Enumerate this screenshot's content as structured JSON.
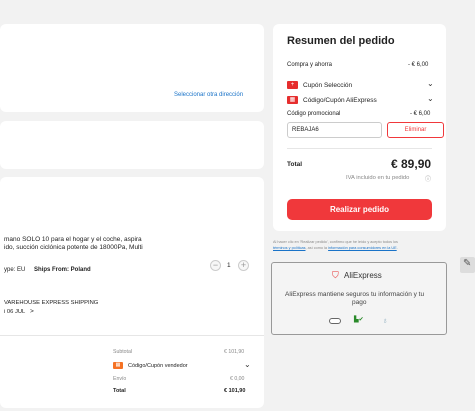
{
  "address": {
    "select_other": "Seleccionar otra dirección"
  },
  "product": {
    "title_line1": "mano SOLO 10 para el hogar y el coche, aspira",
    "title_line2": "ido, succión ciclónica potente de 18000Pa, Multi",
    "type_label": "ype: EU",
    "ships_from": "Ships From: Poland",
    "quantity": "1",
    "shipping_method": "VAREHOUSE EXPRESS SHIPPING",
    "delivery": "i 06 JUL",
    "delivery_chevron": ">"
  },
  "store_summary": {
    "subtotal_label": "Subtotal",
    "subtotal_value": "€ 101,90",
    "seller_coupon_label": "Código/Cupón vendedor",
    "shipping_label": "Envío",
    "shipping_value": "€ 0,00",
    "total_label": "Total",
    "total_value": "€ 101,90"
  },
  "order_summary": {
    "title": "Resumen del pedido",
    "buy_save_label": "Compra y ahorra",
    "buy_save_value": "- € 6,00",
    "coupon_selection_label": "Cupón Selección",
    "aliexpress_coupon_label": "Código/Cupón AliExpress",
    "promo_code_label": "Código promocional",
    "promo_code_value": "- € 6,00",
    "promo_code_input": "REBAJA6",
    "remove_button": "Eliminar",
    "total_label": "Total",
    "total_value": "€ 89,90",
    "vat_note": "IVA incluido en tu pedido",
    "place_order_button": "Realizar pedido",
    "legal_line1": "Al hacer clic en 'Realizar pedido', confirmo que he leído y acepto todos los",
    "legal_line2_a": "términos y políticas",
    "legal_line2_b": ", así como la ",
    "legal_line2_c": "información para consumidores en la UE",
    "legal_line2_d": "."
  },
  "security": {
    "brand": "AliExpress",
    "message_line1": "AliExpress mantiene seguros tu información y tu",
    "message_line2": "pago"
  },
  "colors": {
    "accent": "#f0383b",
    "link": "#1a73c8",
    "background": "#f2f2f2"
  }
}
